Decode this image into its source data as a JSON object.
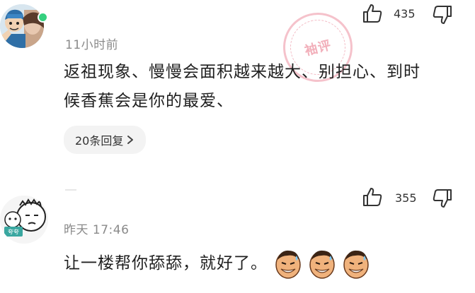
{
  "comments": [
    {
      "time": "11小时前",
      "text_line1": "返祖现象、慢慢会面积越来越大、别担心、到时",
      "text_line2": "候香蕉会是你的最爱、",
      "likes": "435",
      "reply_button": "20条回复",
      "online": true
    },
    {
      "time": "昨天 17:46",
      "text": "让一楼帮你舔舔，就好了。",
      "likes": "355",
      "emoji_count": 3
    }
  ],
  "watermark": {
    "text": "袖评"
  },
  "colors": {
    "online": "#35d07f",
    "stamp": "#e8788c",
    "reply_bg": "#f3f3f3"
  }
}
